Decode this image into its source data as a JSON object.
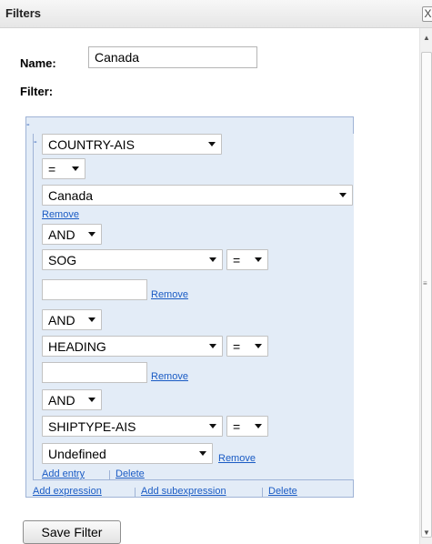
{
  "dialog": {
    "title": "Filters",
    "close_label": "X"
  },
  "form": {
    "name_label": "Name:",
    "name_value": "Canada",
    "filter_label": "Filter:"
  },
  "expression": {
    "collapse_outer": "-",
    "collapse_inner": "-",
    "conditions": [
      {
        "field": "COUNTRY-AIS",
        "operator": "=",
        "value": "Canada",
        "remove_label": "Remove"
      },
      {
        "connector": "AND",
        "field": "SOG",
        "operator": "=",
        "value": "",
        "remove_label": "Remove"
      },
      {
        "connector": "AND",
        "field": "HEADING",
        "operator": "=",
        "value": "",
        "remove_label": "Remove"
      },
      {
        "connector": "AND",
        "field": "SHIPTYPE-AIS",
        "operator": "=",
        "value": "Undefined",
        "remove_label": "Remove"
      }
    ],
    "inner_links": {
      "add_entry": "Add entry",
      "delete": "Delete"
    },
    "outer_links": {
      "add_expression": "Add expression",
      "add_subexpression": "Add subexpression",
      "delete": "Delete"
    }
  },
  "footer": {
    "save_label": "Save Filter"
  },
  "colors": {
    "panel_bg": "#e3ecf7",
    "panel_border": "#9fb3d6",
    "link": "#1a5bc4"
  }
}
